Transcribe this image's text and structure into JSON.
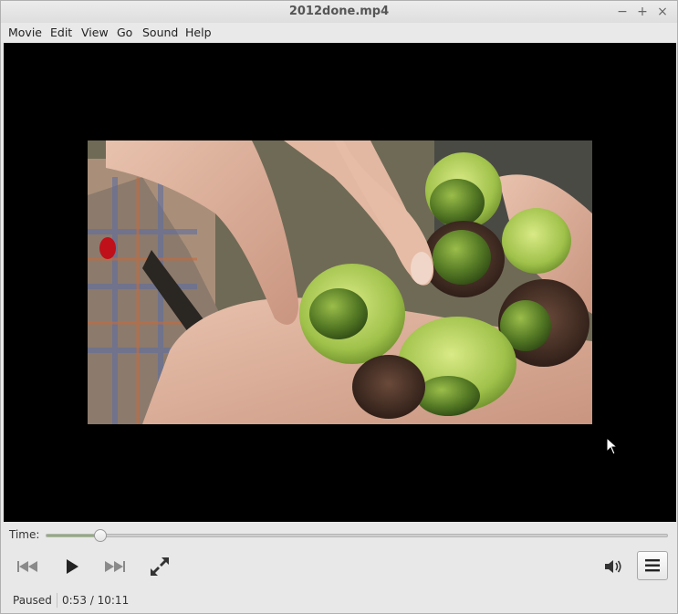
{
  "window": {
    "title": "2012done.mp4",
    "controls": {
      "minimize": "−",
      "maximize": "+",
      "close": "×"
    }
  },
  "menubar": {
    "items": [
      {
        "label": "Movie"
      },
      {
        "label": "Edit"
      },
      {
        "label": "View"
      },
      {
        "label": "Go"
      },
      {
        "label": "Sound"
      },
      {
        "label": "Help"
      }
    ]
  },
  "seek": {
    "label": "Time:",
    "elapsed": "0:53",
    "total": "10:11",
    "fraction": 0.0868
  },
  "controls": {
    "previous_icon": "skip-back-icon",
    "play_icon": "play-icon",
    "next_icon": "skip-forward-icon",
    "fullscreen_icon": "fullscreen-icon",
    "volume_icon": "volume-icon",
    "menu_icon": "hamburger-menu-icon"
  },
  "status": {
    "state": "Paused",
    "time": "0:53 / 10:11"
  },
  "colors": {
    "video_background": "#000000",
    "seek_fill": "#8ab36a",
    "window_background": "#e8e8e8"
  }
}
